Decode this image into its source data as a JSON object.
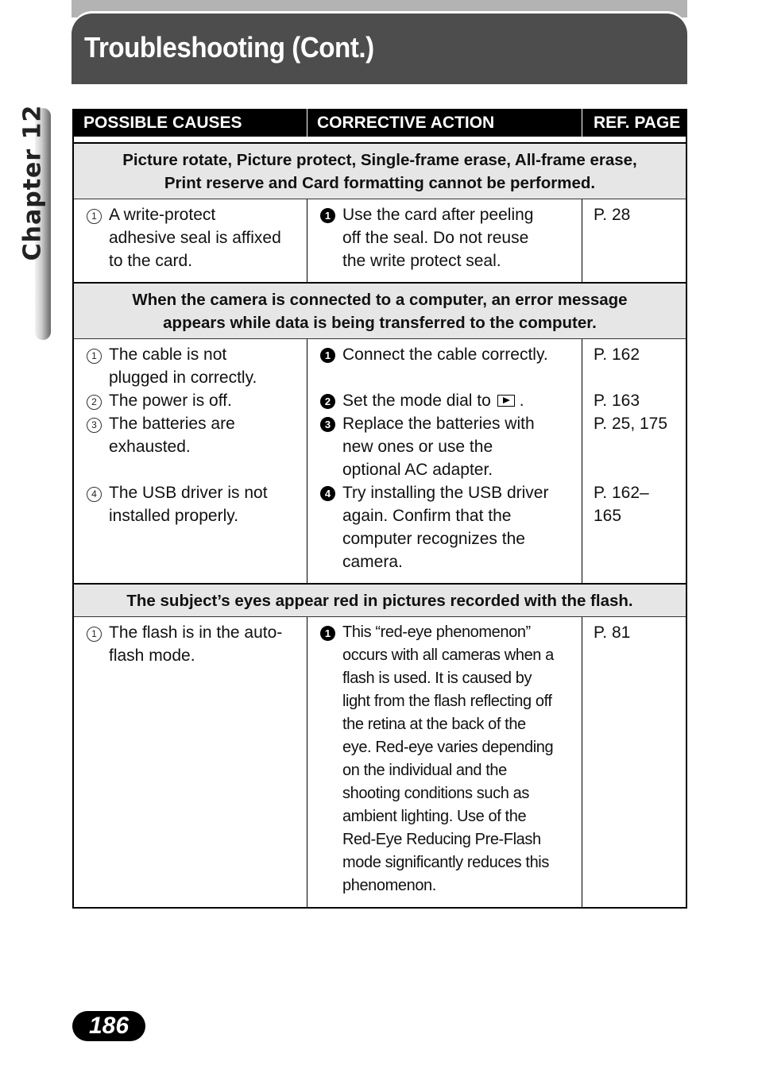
{
  "header": {
    "title": "Troubleshooting (Cont.)",
    "chapter": "Chapter 12"
  },
  "table": {
    "columns": [
      "POSSIBLE CAUSES",
      "CORRECTIVE ACTION",
      "REF. PAGE"
    ],
    "sections": [
      {
        "heading_lines": [
          "Picture rotate, Picture protect, Single-frame erase, All-frame erase,",
          "Print reserve and Card formatting cannot be performed."
        ],
        "causes": [
          {
            "num": "1",
            "lines": [
              "A write-protect",
              "adhesive seal is affixed",
              "to the card."
            ]
          }
        ],
        "actions": [
          {
            "num": "1",
            "lines": [
              "Use the card after peeling",
              "off the seal. Do not reuse",
              "the write protect seal."
            ]
          }
        ],
        "refs": [
          "P. 28"
        ]
      },
      {
        "heading_lines": [
          "When the camera is connected to a computer, an error message",
          "appears while data is being transferred to the computer."
        ],
        "causes": [
          {
            "num": "1",
            "lines": [
              "The cable is not",
              "plugged in correctly."
            ]
          },
          {
            "num": "2",
            "lines": [
              "The power is off."
            ]
          },
          {
            "num": "3",
            "lines": [
              "The batteries are",
              "exhausted."
            ]
          },
          {
            "num": "4",
            "lines": [
              "The USB driver is not",
              "installed properly."
            ]
          }
        ],
        "actions": [
          {
            "num": "1",
            "lines": [
              "Connect the cable correctly."
            ]
          },
          {
            "num": "2",
            "text_before_icon": "Set the mode dial to",
            "icon": "playback-mode-icon",
            "text_after_icon": "."
          },
          {
            "num": "3",
            "lines": [
              "Replace the batteries with",
              "new ones or use the",
              "optional AC adapter."
            ]
          },
          {
            "num": "4",
            "lines": [
              "Try installing the USB driver",
              "again. Confirm that the",
              "computer recognizes the",
              "camera."
            ]
          }
        ],
        "refs": [
          "P. 162",
          "P. 163",
          "P. 25, 175",
          "P. 162–",
          "165"
        ]
      },
      {
        "heading_lines": [
          "The subject’s eyes appear red in pictures recorded with the flash."
        ],
        "causes": [
          {
            "num": "1",
            "lines": [
              "The flash is in the auto-",
              "flash mode."
            ]
          }
        ],
        "actions": [
          {
            "num": "1",
            "lines": [
              "This “red-eye phenomenon”",
              "occurs with all cameras when a",
              "flash is used. It is caused by",
              "light from the flash reflecting off",
              "the retina at the back of the",
              "eye. Red-eye varies depending",
              "on the individual and the",
              "shooting conditions such as",
              "ambient lighting. Use of the",
              "Red-Eye Reducing Pre-Flash",
              "mode significantly reduces this",
              "phenomenon."
            ]
          }
        ],
        "refs": [
          "P. 81"
        ]
      }
    ]
  },
  "footer": {
    "page_number": "186"
  }
}
